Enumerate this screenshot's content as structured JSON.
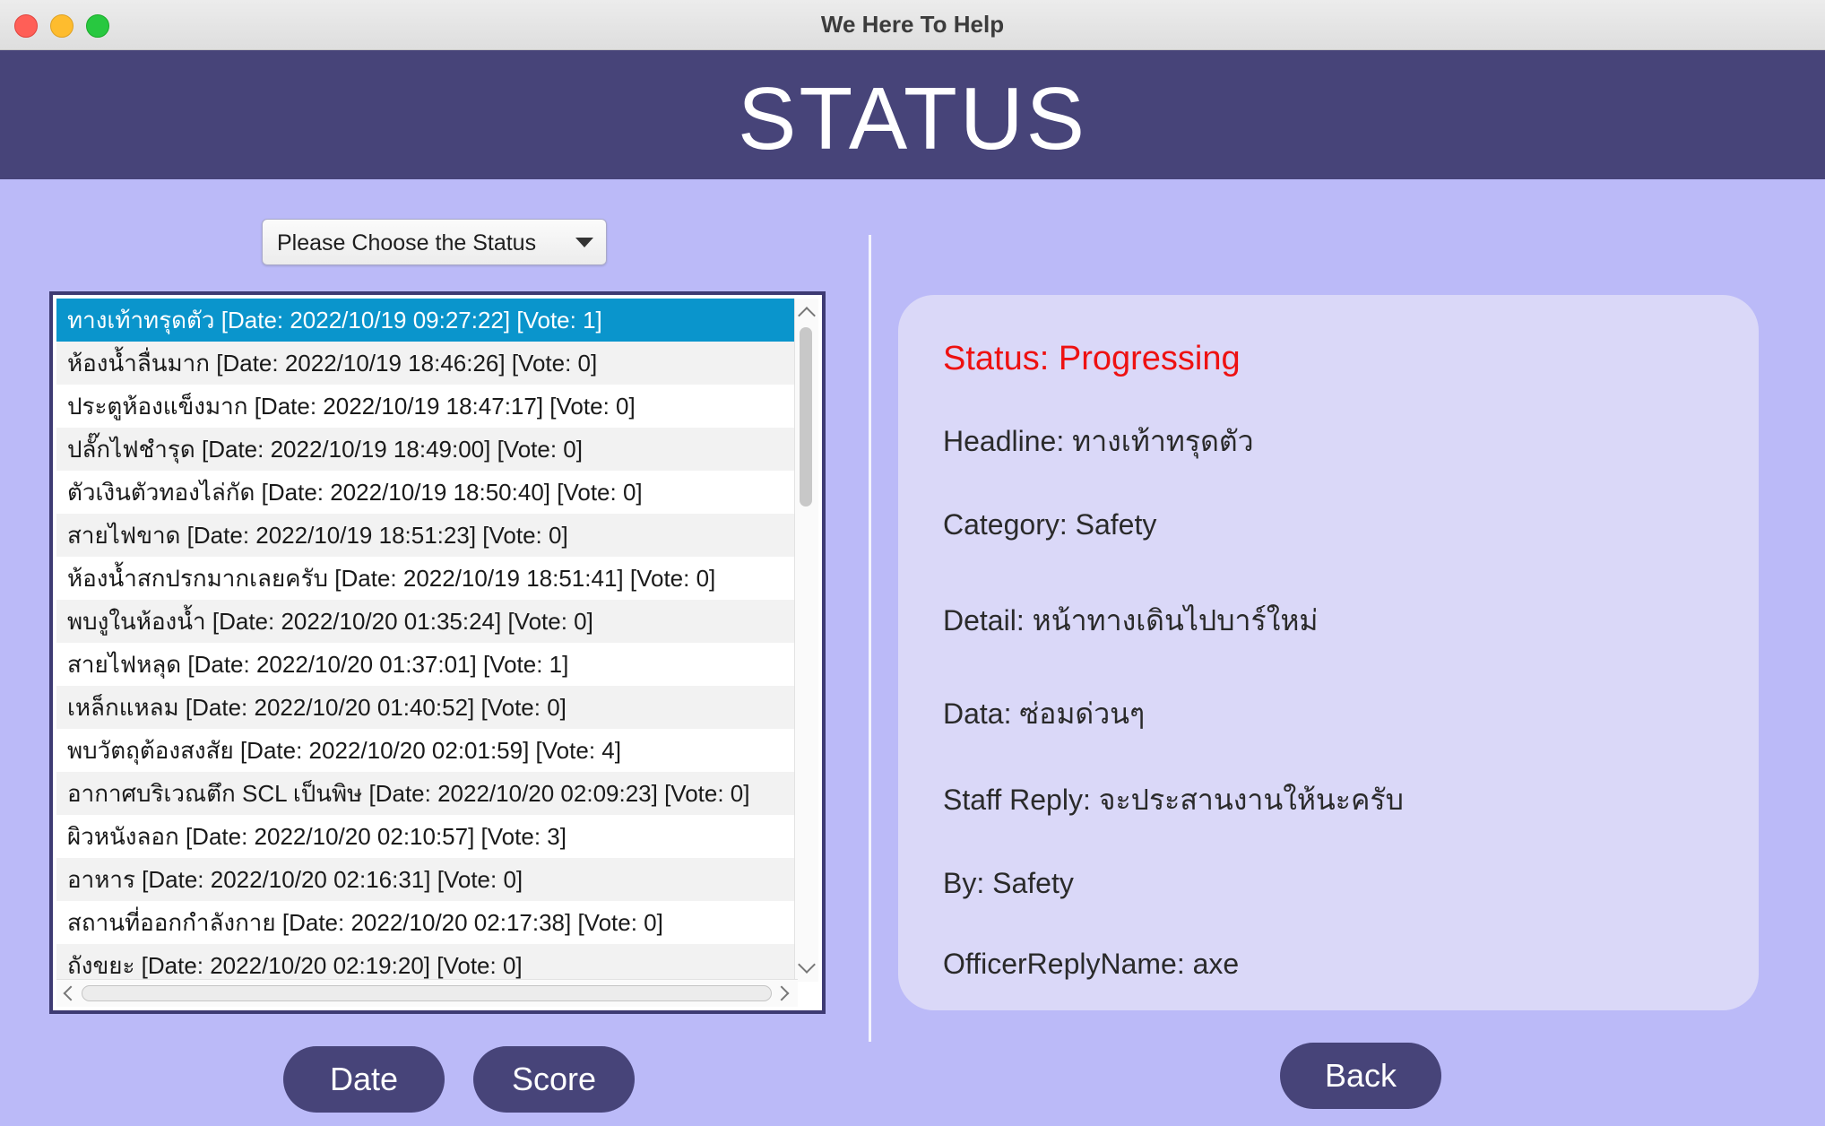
{
  "window": {
    "title": "We Here To Help"
  },
  "header": {
    "title": "STATUS"
  },
  "filter": {
    "selected": "Please Choose the Status"
  },
  "reports": [
    "ทางเท้าทรุดตัว  [Date: 2022/10/19 09:27:22]  [Vote: 1]",
    "ห้องน้ำลื่นมาก  [Date: 2022/10/19 18:46:26]  [Vote: 0]",
    "ประตูห้องแข็งมาก  [Date: 2022/10/19 18:47:17]  [Vote: 0]",
    "ปลั๊กไฟชำรุด  [Date: 2022/10/19 18:49:00]  [Vote: 0]",
    "ตัวเงินตัวทองไล่กัด  [Date: 2022/10/19 18:50:40]  [Vote: 0]",
    "สายไฟขาด  [Date: 2022/10/19 18:51:23]  [Vote: 0]",
    "ห้องน้ำสกปรกมากเลยครับ  [Date: 2022/10/19 18:51:41]  [Vote: 0]",
    "พบงูในห้องน้ำ  [Date: 2022/10/20 01:35:24]  [Vote: 0]",
    "สายไฟหลุด  [Date: 2022/10/20 01:37:01]  [Vote: 1]",
    "เหล็กแหลม  [Date: 2022/10/20 01:40:52]  [Vote: 0]",
    "พบวัตถุต้องสงสัย  [Date: 2022/10/20 02:01:59]  [Vote: 4]",
    "อากาศบริเวณตึก SCL เป็นพิษ  [Date: 2022/10/20 02:09:23]  [Vote: 0]",
    "ผิวหนังลอก  [Date: 2022/10/20 02:10:57]  [Vote: 3]",
    "อาหาร  [Date: 2022/10/20 02:16:31]  [Vote: 0]",
    "สถานที่ออกกำลังกาย  [Date: 2022/10/20 02:17:38]  [Vote: 0]",
    "ถังขยะ  [Date: 2022/10/20 02:19:20]  [Vote: 0]"
  ],
  "detail": {
    "status": "Status: Progressing",
    "headline": "Headline: ทางเท้าทรุดตัว",
    "category": "Category: Safety",
    "detail": "Detail: หน้าทางเดินไปบาร์ใหม่",
    "data": "Data: ซ่อมด่วนๆ",
    "staff_reply": "Staff Reply: จะประสานงานให้นะครับ",
    "by": "By: Safety",
    "officer": "OfficerReplyName: axe"
  },
  "buttons": {
    "date": "Date",
    "score": "Score",
    "back": "Back"
  },
  "colors": {
    "banner": "#474479",
    "background": "#bbbaf8",
    "selection": "#0a95cc",
    "status_text": "#ee1111"
  }
}
